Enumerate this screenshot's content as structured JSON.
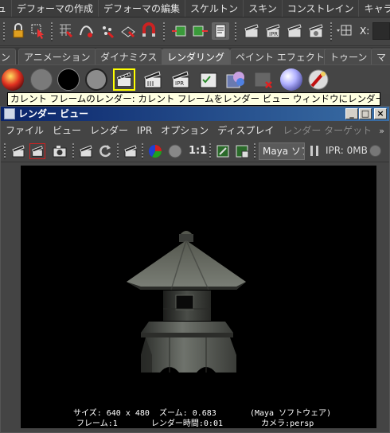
{
  "menubar": {
    "items": [
      "ュ",
      "デフォーマの作成",
      "デフォーマの編集",
      "スケルトン",
      "スキン",
      "コンストレイン",
      "キャラクタ"
    ]
  },
  "statusline": {
    "x_label": "X:"
  },
  "shelf": {
    "tabs": [
      "ン",
      "アニメーション",
      "ダイナミクス",
      "レンダリング",
      "ペイント エフェクト",
      "トゥーン",
      "マ"
    ],
    "active_tab": "レンダリング",
    "icons": [
      "hypershade-ball-icon",
      "grey-ball-icon",
      "black-ball-icon",
      "light-grey-ball-icon",
      "render-current-frame-icon",
      "batch-render-icon",
      "ipr-render-icon",
      "render-settings-icon",
      "hypershade-window-icon",
      "render-delete-icon",
      "material-ball-icon",
      "paint-brush-icon"
    ]
  },
  "tooltip": {
    "text": "カレント フレームのレンダー: カレント フレームをレンダー ビュー ウィンドウにレンダーします"
  },
  "render_view": {
    "title": "レンダー ビュー",
    "window_buttons": [
      "_",
      "□",
      "×"
    ],
    "menu": [
      "ファイル",
      "ビュー",
      "レンダー",
      "IPR",
      "オプション",
      "ディスプレイ",
      "レンダー ターゲット"
    ],
    "menu_more": "»",
    "ratio_label": "1:1",
    "renderer_label": "Maya ソフ",
    "ipr_memory": "IPR: 0MB",
    "info_line1": "サイズ: 640 x 480  ズーム: 0.683       (Maya ソフトウェア)",
    "info_line2": "フレーム:1       レンダー時間:0:01        カメラ:persp"
  },
  "colors": {
    "tooltip_bg": "#ffffe1",
    "titlebar_start": "#0a246a",
    "titlebar_end": "#3a6ea5",
    "active_shelf_icon_border": "#ffff00"
  }
}
